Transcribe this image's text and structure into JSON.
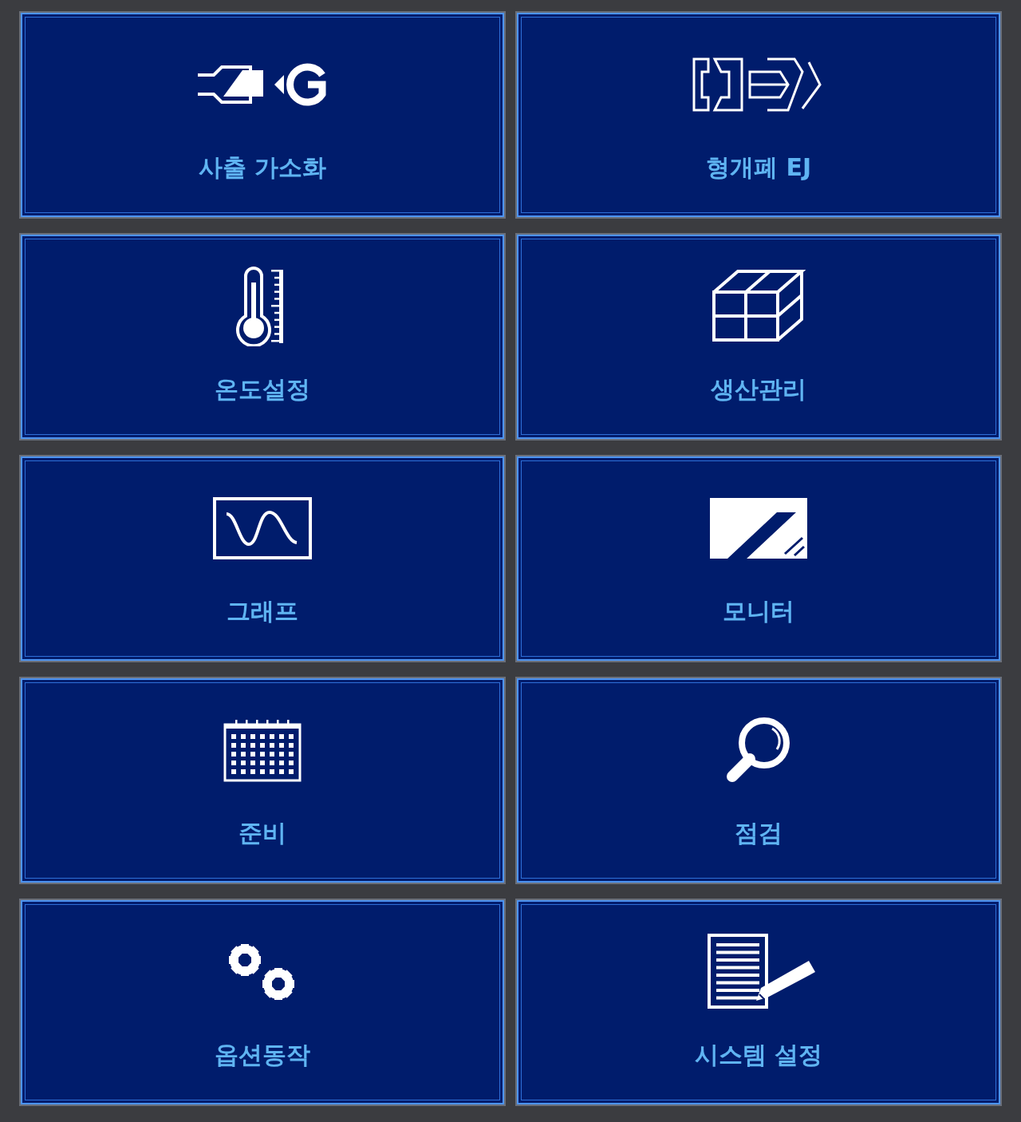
{
  "menu": [
    {
      "label": "사출 가소화",
      "kind": "injection"
    },
    {
      "label": "형개폐 EJ",
      "kind": "mold"
    },
    {
      "label": "온도설정",
      "kind": "thermometer"
    },
    {
      "label": "생산관리",
      "kind": "cubes"
    },
    {
      "label": "그래프",
      "kind": "graph"
    },
    {
      "label": "모니터",
      "kind": "monitor"
    },
    {
      "label": "준비",
      "kind": "calendar"
    },
    {
      "label": "점검",
      "kind": "search"
    },
    {
      "label": "옵션동작",
      "kind": "gears"
    },
    {
      "label": "시스템 설정",
      "kind": "document"
    }
  ]
}
